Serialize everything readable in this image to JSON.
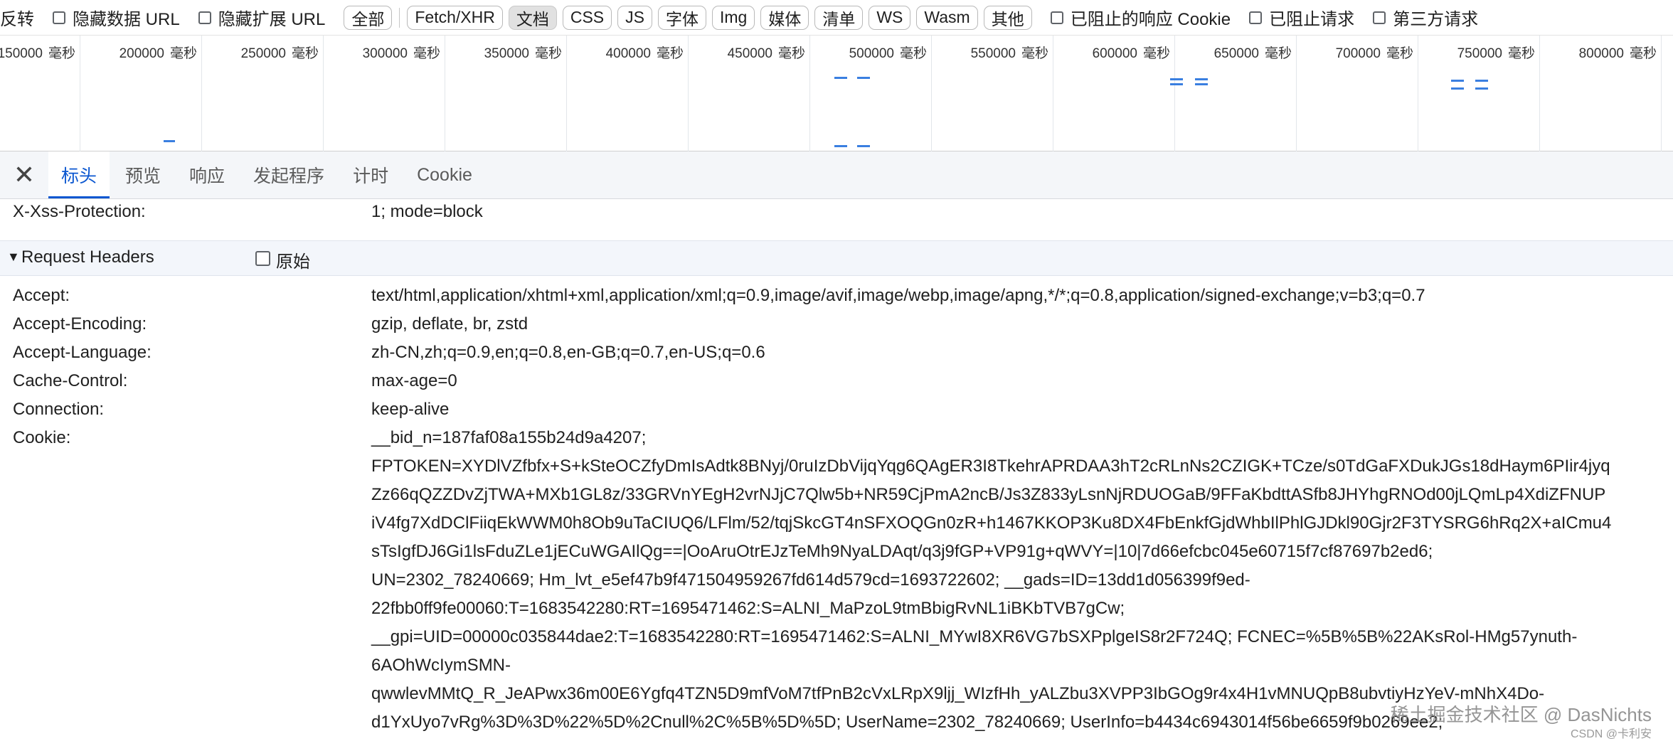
{
  "filter_bar": {
    "invert_label": "反转",
    "hide_data_urls_label": "隐藏数据 URL",
    "hide_extension_urls_label": "隐藏扩展 URL",
    "types": [
      "全部",
      "Fetch/XHR",
      "文档",
      "CSS",
      "JS",
      "字体",
      "Img",
      "媒体",
      "清单",
      "WS",
      "Wasm",
      "其他"
    ],
    "active_type": "文档",
    "blocked_cookies_label": "已阻止的响应 Cookie",
    "blocked_requests_label": "已阻止请求",
    "third_party_label": "第三方请求"
  },
  "overview": {
    "unit": "毫秒",
    "ticks": [
      "150000",
      "200000",
      "250000",
      "300000",
      "350000",
      "400000",
      "450000",
      "500000",
      "550000",
      "600000",
      "650000",
      "700000",
      "750000",
      "800000"
    ]
  },
  "tabs": {
    "close_icon": "close-icon",
    "items": [
      "标头",
      "预览",
      "响应",
      "发起程序",
      "计时",
      "Cookie"
    ],
    "active": "标头"
  },
  "response_headers_tail": {
    "key": "X-Xss-Protection:",
    "value": "1; mode=block"
  },
  "request_headers": {
    "title": "Request Headers",
    "raw_label": "原始",
    "rows": [
      {
        "key": "Accept:",
        "value": "text/html,application/xhtml+xml,application/xml;q=0.9,image/avif,image/webp,image/apng,*/*;q=0.8,application/signed-exchange;v=b3;q=0.7"
      },
      {
        "key": "Accept-Encoding:",
        "value": "gzip, deflate, br, zstd"
      },
      {
        "key": "Accept-Language:",
        "value": "zh-CN,zh;q=0.9,en;q=0.8,en-GB;q=0.7,en-US;q=0.6"
      },
      {
        "key": "Cache-Control:",
        "value": "max-age=0"
      },
      {
        "key": "Connection:",
        "value": "keep-alive"
      },
      {
        "key": "Cookie:",
        "value": "__bid_n=187faf08a155b24d9a4207;"
      }
    ],
    "cookie_lines": [
      "FPTOKEN=XYDlVZfbfx+S+kSteOCZfyDmIsAdtk8BNyj/0ruIzDbVijqYqg6QAgER3I8TkehrAPRDAA3hT2cRLnNs2CZIGK+TCze/s0TdGaFXDukJGs18dHaym6PIir4jyq",
      "Zz66qQZZDvZjTWA+MXb1GL8z/33GRVnYEgH2vrNJjC7Qlw5b+NR59CjPmA2ncB/Js3Z833yLsnNjRDUOGaB/9FFaKbdttASfb8JHYhgRNOd00jLQmLp4XdiZFNUP",
      "iV4fg7XdDClFiiqEkWWM0h8Ob9uTaCIUQ6/LFlm/52/tqjSkcGT4nSFXOQGn0zR+h1467KKOP3Ku8DX4FbEnkfGjdWhbIlPhlGJDkl90Gjr2F3TYSRG6hRq2X+aICmu4",
      "sTsIgfDJ6Gi1lsFduZLe1jECuWGAIlQg==|OoAruOtrEJzTeMh9NyaLDAqt/q3j9fGP+VP91g+qWVY=|10|7d66efcbc045e60715f7cf87697b2ed6;",
      "UN=2302_78240669; Hm_lvt_e5ef47b9f471504959267fd614d579cd=1693722602; __gads=ID=13dd1d056399f9ed-",
      "22fbb0ff9fe00060:T=1683542280:RT=1695471462:S=ALNI_MaPzoL9tmBbigRvNL1iBKbTVB7gCw;",
      "__gpi=UID=00000c035844dae2:T=1683542280:RT=1695471462:S=ALNI_MYwI8XR6VG7bSXPplgeIS8r2F724Q; FCNEC=%5B%5B%22AKsRol-HMg57ynuth-",
      "6AOhWcIymSMN-",
      "qwwlevMMtQ_R_JeAPwx36m00E6Ygfq4TZN5D9mfVoM7tfPnB2cVxLRpX9ljj_WIzfHh_yALZbu3XVPP3IbGOg9r4x4H1vMNUQpB8ubvtiyHzYeV-mNhX4Do-",
      "d1YxUyo7vRg%3D%3D%22%5D%2Cnull%2C%5B%5D%5D; UserName=2302_78240669; UserInfo=b4434c6943014f56be6659f9b0269ee2;"
    ]
  },
  "watermark": {
    "text": "稀土掘金技术社区 @ DasNichts",
    "sub": "CSDN @卡利安"
  }
}
